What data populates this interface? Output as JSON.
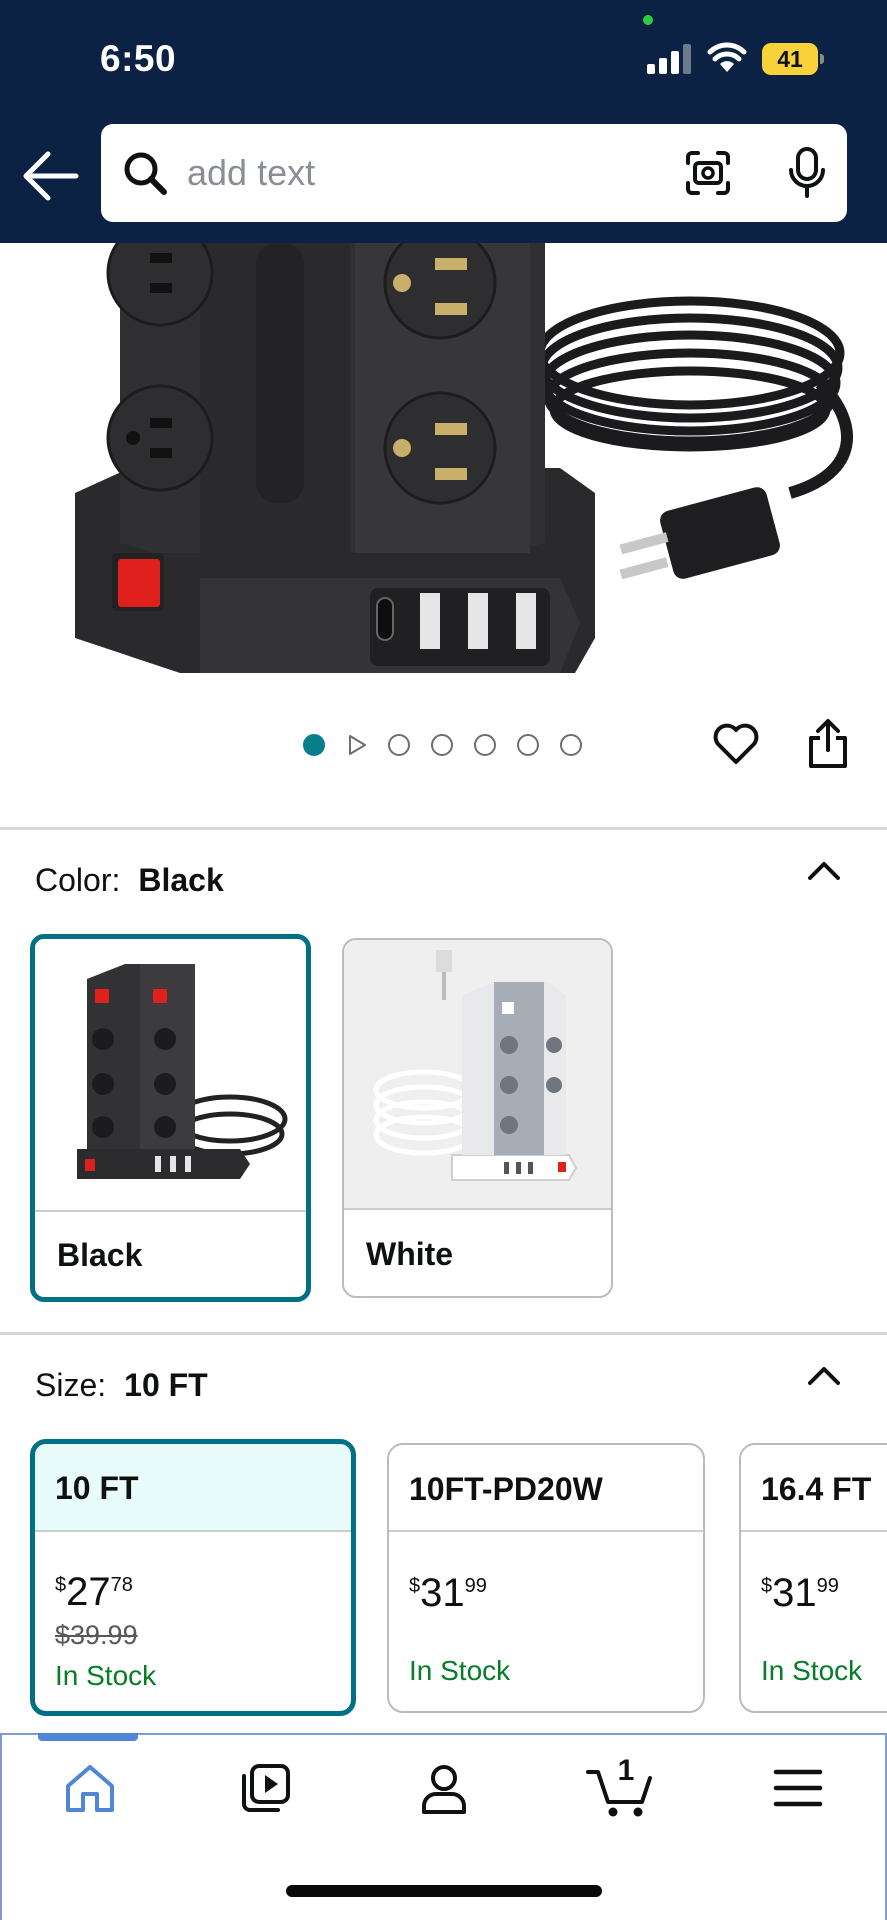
{
  "status_bar": {
    "time": "6:50",
    "battery": "41",
    "battery_color": "#f7d23a"
  },
  "header": {
    "background": "#0b2244",
    "search_placeholder": "add text",
    "icons": [
      "back-arrow-icon",
      "search-icon",
      "camera-lens-icon",
      "microphone-icon"
    ]
  },
  "product_image": {
    "description_icons": [
      "heart-icon",
      "share-icon"
    ],
    "image_count": 7,
    "active_index": 0,
    "has_video": true
  },
  "color": {
    "label": "Color:",
    "selected": "Black",
    "options": [
      {
        "label": "Black"
      },
      {
        "label": "White"
      }
    ]
  },
  "size": {
    "label": "Size:",
    "selected": "10 FT",
    "options": [
      {
        "name": "10 FT",
        "currency": "$",
        "whole": "27",
        "fraction": "78",
        "list_price": "$39.99",
        "stock": "In Stock"
      },
      {
        "name": "10FT-PD20W",
        "currency": "$",
        "whole": "31",
        "fraction": "99",
        "list_price": "",
        "stock": "In Stock"
      },
      {
        "name": "16.4 FT",
        "currency": "$",
        "whole": "31",
        "fraction": "99",
        "list_price": "",
        "stock": "In Stock"
      }
    ]
  },
  "bottom_nav": {
    "items": [
      "home-icon",
      "video-icon",
      "account-icon",
      "cart-icon",
      "menu-icon"
    ],
    "cart_count": "1",
    "active": "home-icon"
  },
  "colors": {
    "accent_teal": "#007185",
    "in_stock_green": "#067d26",
    "nav_blue": "#4f86d6"
  }
}
